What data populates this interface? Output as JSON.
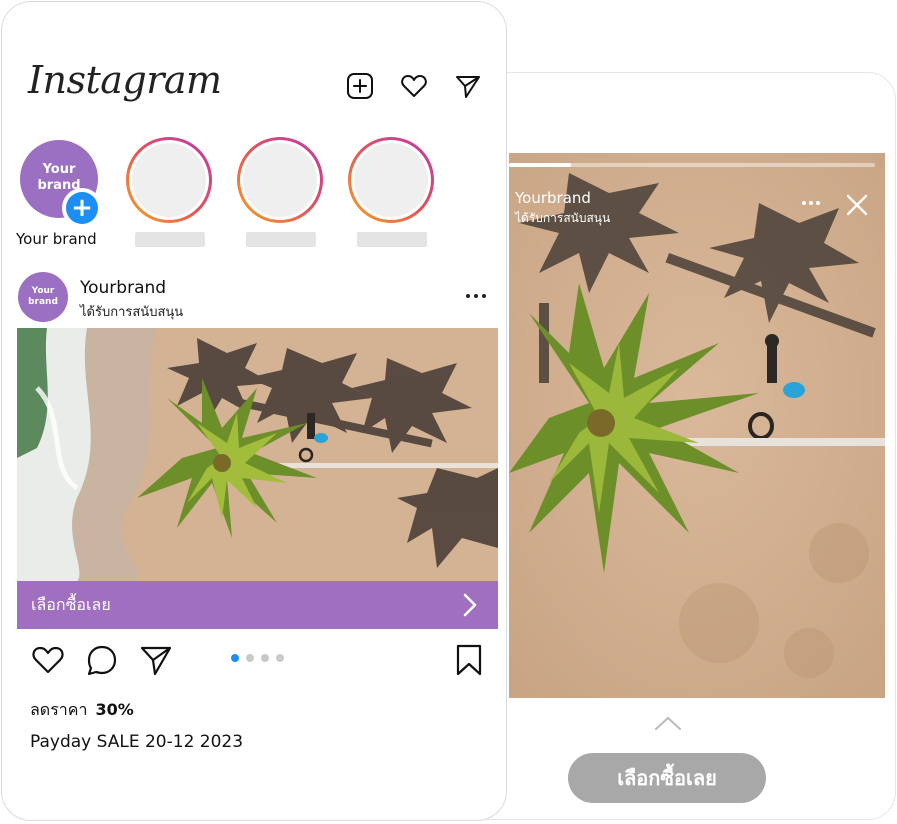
{
  "feed": {
    "logo_text": "Instagram",
    "own_story": {
      "avatar_text": "Your brand",
      "label": "Your brand",
      "add_icon": "plus-icon"
    },
    "stories_placeholder_count": 3,
    "post": {
      "avatar_text": "Your brand",
      "username": "Yourbrand",
      "sponsored": "ได้รับการสนับสนุน",
      "cta_label": "เลือกซื้อเลย",
      "carousel_dots": 4,
      "active_dot": 0,
      "discount_label": "ลดราคา",
      "discount_value": "30%",
      "caption": "Payday SALE 20-12 2023"
    }
  },
  "story": {
    "username": "Yourbrand",
    "sponsored": "ได้รับการสนับสนุน",
    "progress": 0.17,
    "cta_label": "เลือกซื้อเลย"
  },
  "colors": {
    "brand_purple": "#a06fc0",
    "blue_accent": "#1c8ef5",
    "story_cta_gray": "#a8a8a8"
  }
}
